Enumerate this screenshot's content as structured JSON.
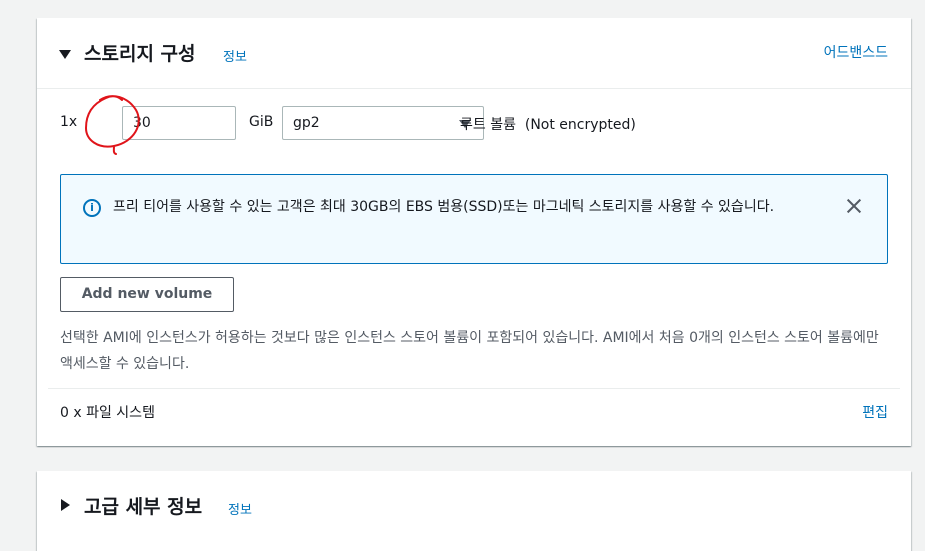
{
  "storage": {
    "title": "스토리지 구성",
    "info_link": "정보",
    "advanced_link": "어드밴스드",
    "volume": {
      "count_label": "1x",
      "size_value": "30",
      "unit_label": "GiB",
      "type_selected": "gp2",
      "description": "루트 볼륨  (Not encrypted)"
    },
    "alert": {
      "message": "프리 티어를 사용할 수 있는 고객은 최대 30GB의 EBS 범용(SSD)또는 마그네틱 스토리지를 사용할 수 있습니다."
    },
    "add_volume_label": "Add new volume",
    "ami_description": "선택한 AMI에 인스턴스가 허용하는 것보다 많은 인스턴스 스토어 볼륨이 포함되어 있습니다. AMI에서 처음 0개의 인스턴스 스토어 볼륨에만 액세스할 수 있습니다.",
    "file_systems_label": "0 x 파일 시스템",
    "edit_link": "편집"
  },
  "advanced": {
    "title": "고급 세부 정보",
    "info_link": "정보"
  },
  "colors": {
    "link": "#0073bb",
    "annotation": "#e0141a",
    "alert_bg": "#f1faff"
  }
}
